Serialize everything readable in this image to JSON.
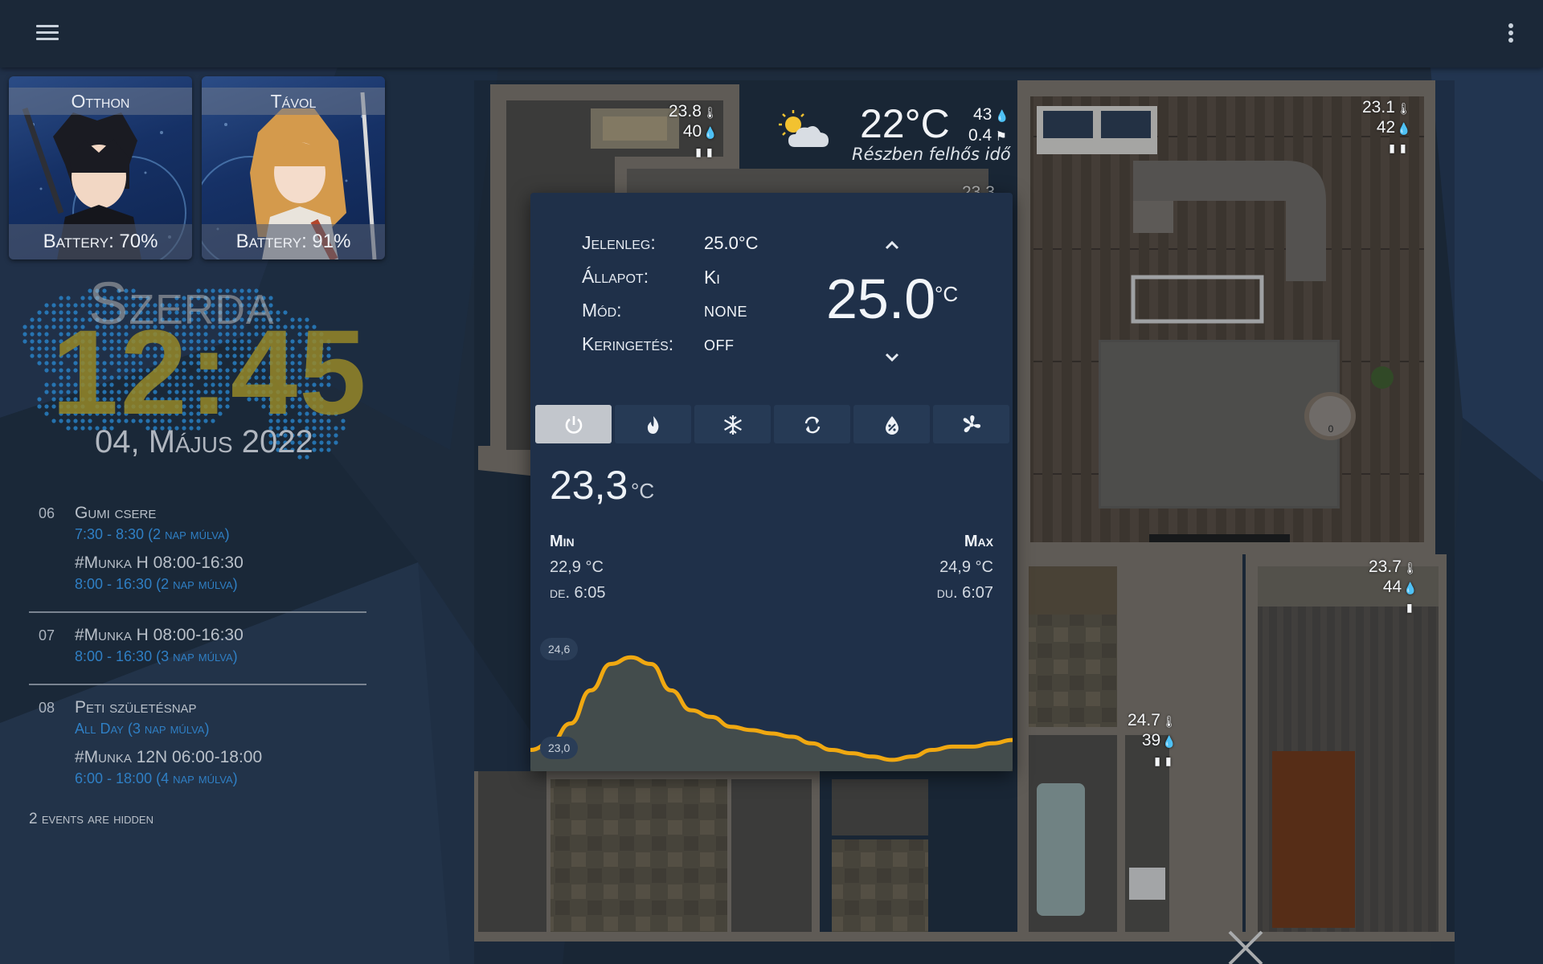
{
  "colors": {
    "background": "#1d2b3c",
    "topbar": "#1b2838",
    "thermostat_panel": "#1f3049",
    "graph_line": "#f0a811",
    "calendar_accent": "#2f7fc4",
    "clock": "#968728"
  },
  "topbar": {
    "menu_icon": "hamburger-menu-icon",
    "more_icon": "more-vertical-icon"
  },
  "persons": [
    {
      "name": "Otthon",
      "battery": "Battery: 70%"
    },
    {
      "name": "Távol",
      "battery": "Battery: 91%"
    }
  ],
  "clock": {
    "day": "Szerda",
    "time": "12:45",
    "date": "04, Május 2022"
  },
  "calendar": {
    "days": [
      {
        "day": "06",
        "events": [
          {
            "title": "Gumi csere",
            "time": "7:30 - 8:30  (2 nap múlva)"
          },
          {
            "title": "#Munka H 08:00-16:30",
            "time": "8:00 - 16:30  (2 nap múlva)"
          }
        ]
      },
      {
        "day": "07",
        "events": [
          {
            "title": "#Munka H 08:00-16:30",
            "time": "8:00 - 16:30  (3 nap múlva)"
          }
        ]
      },
      {
        "day": "08",
        "events": [
          {
            "title": "Peti születésnap",
            "time": "All Day  (3 nap múlva)"
          },
          {
            "title": "#Munka 12N 06:00-18:00",
            "time": "6:00 - 18:00     (4 nap múlva)"
          }
        ]
      }
    ],
    "hidden_note": "2 events are hidden"
  },
  "weather": {
    "temperature": "22°C",
    "condition": "Részben felhős idő",
    "humidity": "43",
    "wind": "0.4",
    "icon": "partly-cloudy-icon"
  },
  "sensors": [
    {
      "temp": "23.8",
      "humidity": "40"
    },
    {
      "temp": "23.1",
      "humidity": "42"
    },
    {
      "temp": "23.7",
      "humidity": "44"
    },
    {
      "temp": "24.7",
      "humidity": "39"
    },
    {
      "hidden_temp": "23.3"
    }
  ],
  "vacuum_label": "0",
  "thermostat": {
    "rows": [
      {
        "label": "Jelenleg:",
        "value": "25.0°C"
      },
      {
        "label": "Állapot:",
        "value": "Ki"
      },
      {
        "label": "Mód:",
        "value": "none"
      },
      {
        "label": "Keringetés:",
        "value": "off"
      }
    ],
    "setpoint": "25.0",
    "setpoint_unit": "°C",
    "modes": [
      "power-icon",
      "flame-icon",
      "snowflake-icon",
      "auto-cycle-icon",
      "dry-icon",
      "fan-icon"
    ],
    "active_mode": "power-icon",
    "current": "23,3",
    "current_unit": "°C",
    "min_label": "Min",
    "max_label": "Max",
    "min_value": "22,9 °C",
    "max_value": "24,9 °C",
    "min_time": "de. 6:05",
    "max_time": "du. 6:07",
    "graph_max_label": "24,6",
    "graph_min_label": "23,0",
    "history": [
      23.2,
      23.3,
      23.6,
      24.1,
      24.5,
      24.6,
      24.5,
      24.1,
      23.8,
      23.7,
      23.55,
      23.5,
      23.45,
      23.4,
      23.3,
      23.2,
      23.15,
      23.1,
      23.05,
      23.1,
      23.2,
      23.25,
      23.25,
      23.3,
      23.35
    ]
  }
}
